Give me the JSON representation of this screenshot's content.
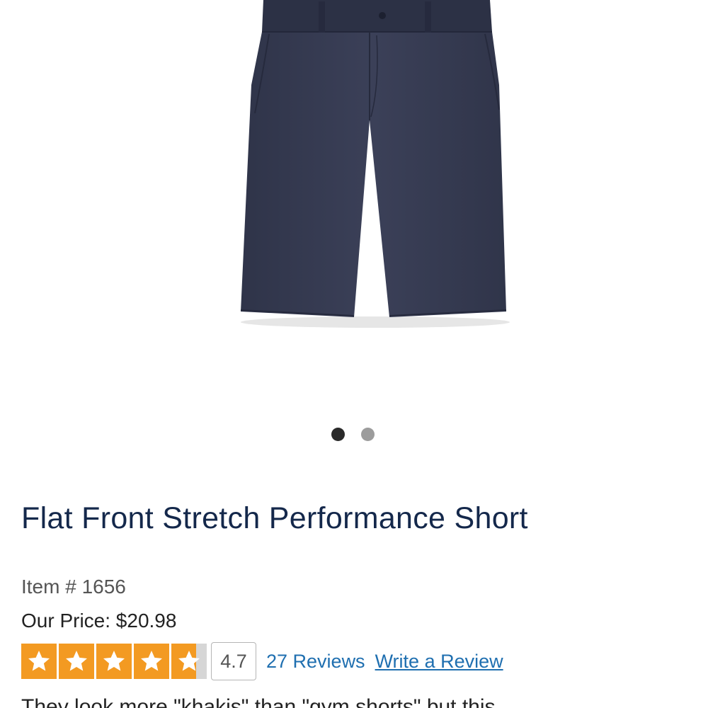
{
  "product": {
    "title": "Flat Front Stretch Performance Short",
    "item_number": "Item # 1656",
    "price": "Our Price: $20.98",
    "rating_value": "4.7",
    "rating_fraction": 0.94,
    "stars_total": 5,
    "reviews_link": "27 Reviews",
    "write_review_link": "Write a Review",
    "description_preview": "They look more \"khakis\" than \"gym shorts\" but this"
  },
  "carousel": {
    "image_count": 2,
    "active_index": 0
  },
  "icons": {
    "star": "star-icon",
    "product_image": "navy-shorts-image"
  },
  "colors": {
    "title": "#14284b",
    "star_fill": "#f39a22",
    "star_empty": "#d6d6d6",
    "link": "#1f6fb0",
    "shorts": "#3a3f55"
  }
}
